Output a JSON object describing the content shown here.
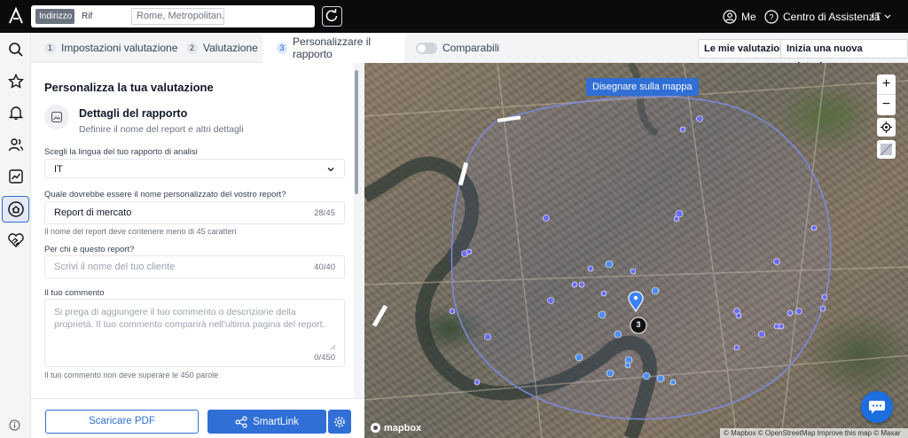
{
  "header": {
    "search_mode_address": "Indirizzo",
    "search_mode_ref": "Rif",
    "search_value": "Rome, Metropolitan...",
    "user_label": "Me",
    "help_label": "Centro di Assistenza",
    "language": "IT"
  },
  "tabs": {
    "items": [
      {
        "num": "1",
        "label": "Impostazioni valutazione"
      },
      {
        "num": "2",
        "label": "Valutazione"
      },
      {
        "num": "3",
        "label": "Personalizzare il rapporto"
      }
    ],
    "comparables_label": "Comparabili",
    "my_valuations": "Le mie valutazioni",
    "new_valuation": "Inizia una nuova valutazione"
  },
  "form": {
    "title": "Personalizza la tua valutazione",
    "section_title": "Dettagli del rapporto",
    "section_subtitle": "Definire il nome del report e altri dettagli",
    "language_label": "Scegli la lingua del tuo rapporto di analisi",
    "language_value": "IT",
    "report_name_label": "Quale dovrebbe essere il nome personalizzato del vostro report?",
    "report_name_value": "Report di mercato",
    "report_name_count": "28/45",
    "report_name_hint": "Il nome del report deve contenere meno di 45 caratteri",
    "client_label": "Per chi è questo report?",
    "client_placeholder": "Scrivi il nome del tuo cliente",
    "client_count": "40/40",
    "comment_label": "Il tuo commento",
    "comment_placeholder": "Si prega di aggiungere il tuo commento o descrizione della proprietà. Il tuo commento comparirà nell'ultima pagina del report.",
    "comment_count": "0/450",
    "comment_hint": "Il tuo commento non deve superare le 450 parole"
  },
  "actions": {
    "download_pdf": "Scaricare PDF",
    "smartlink": "SmartLink"
  },
  "map": {
    "draw_button": "Disegnare sulla mappa",
    "zoom_in": "+",
    "zoom_out": "−",
    "cluster_count": "3",
    "logo_text": "mapbox",
    "attribution": "© Mapbox © OpenStreetMap Improve this map © Maxar",
    "dot_color": "#6b6cf6",
    "accent": "#2f6fd6"
  }
}
